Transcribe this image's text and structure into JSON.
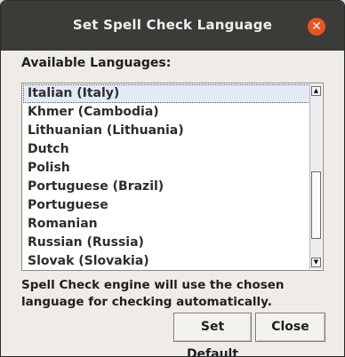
{
  "window": {
    "title": "Set Spell Check Language",
    "close_glyph": "✕"
  },
  "available_label": "Available Languages:",
  "languages": {
    "items": [
      "Italian (Italy)",
      "Khmer (Cambodia)",
      "Lithuanian (Lithuania)",
      "Dutch",
      "Polish",
      "Portuguese (Brazil)",
      "Portuguese",
      "Romanian",
      "Russian (Russia)",
      "Slovak (Slovakia)"
    ],
    "selected": "Italian (Italy)"
  },
  "info_text": "Spell Check engine will use the chosen language for checking automatically.",
  "buttons": {
    "set_default": "Set Default",
    "close": "Close"
  },
  "colors": {
    "titlebar": "#3b3b38",
    "close_button": "#e95420",
    "dialog_bg": "#efebe7",
    "selection_bg": "#e3e9f5"
  }
}
